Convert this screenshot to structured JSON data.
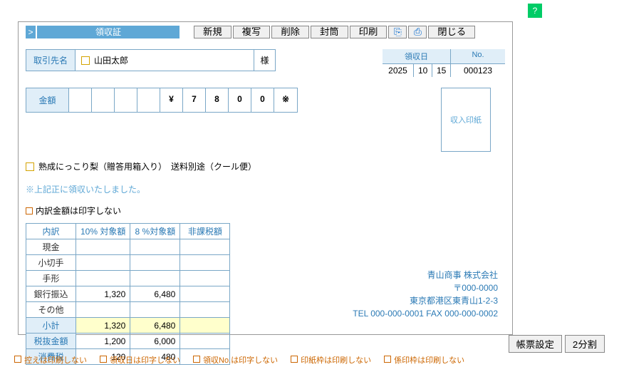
{
  "help": "?",
  "title": "領収証",
  "title_arrow": ">",
  "toolbar": {
    "new": "新規",
    "copy": "複写",
    "delete": "削除",
    "envelope": "封筒",
    "print": "印刷",
    "icon1": "⎘",
    "icon2": "⎙",
    "close": "閉じる"
  },
  "client": {
    "label": "取引先名",
    "name": "山田太郎",
    "sama": "様"
  },
  "date": {
    "hdr": "領収日",
    "y": "2025",
    "m": "10",
    "d": "15",
    "no_hdr": "No.",
    "no": "000123"
  },
  "amount": {
    "label": "金額",
    "d0": "",
    "d1": "",
    "d2": "",
    "d3": "",
    "d4": "¥",
    "d5": "7",
    "d6": "8",
    "d7": "0",
    "d8": "0",
    "d9": "※"
  },
  "stamp": "収入印紙",
  "desc": "熟成にっこり梨（贈答用箱入り）　送料別途（クール便）",
  "note": "※上記正に領収いたしました。",
  "chk1": "内訳金額は印字しない",
  "tbl": {
    "h0": "内訳",
    "h1": "10% 対象額",
    "h2": "8 %対象額",
    "h3": "非課税額",
    "r1": "現金",
    "r2": "小切手",
    "r3": "手形",
    "r4": "銀行振込",
    "r5": "その他",
    "r6": "小計",
    "r7": "税抜金額",
    "r8": "消費税",
    "v4_1": "1,320",
    "v4_2": "6,480",
    "v6_1": "1,320",
    "v6_2": "6,480",
    "v7_1": "1,200",
    "v7_2": "6,000",
    "v8_1": "120",
    "v8_2": "480"
  },
  "company": {
    "name": "青山商事 株式会社",
    "zip": "〒000-0000",
    "addr": "東京都港区東青山1-2-3",
    "tel": "TEL 000-000-0001 FAX 000-000-0002"
  },
  "opts": {
    "o1": "控えは印刷しない",
    "o2": "領収日は印字しない",
    "o3": "領収No.は印字しない",
    "o4": "印紙枠は印刷しない",
    "o5": "係印枠は印刷しない"
  },
  "bottom": {
    "settings": "帳票設定",
    "split": "2分割"
  }
}
